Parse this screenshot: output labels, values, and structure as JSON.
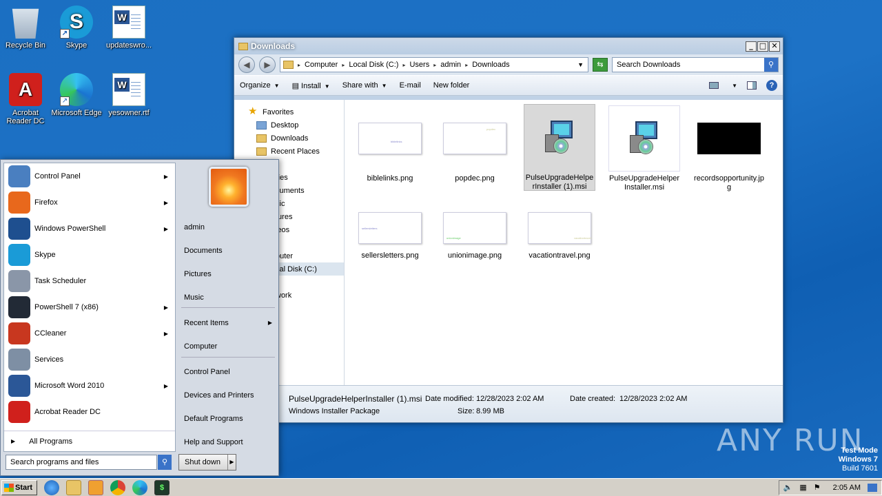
{
  "desktop": {
    "icons": [
      {
        "label": "Recycle Bin"
      },
      {
        "label": "Skype"
      },
      {
        "label": "updateswro..."
      },
      {
        "label": "Acrobat Reader DC"
      },
      {
        "label": "Microsoft Edge"
      },
      {
        "label": "yesowner.rtf"
      }
    ]
  },
  "explorer": {
    "title": "Downloads",
    "nav_back": "◀",
    "nav_forward": "▶",
    "breadcrumb": [
      "Computer",
      "Local Disk (C:)",
      "Users",
      "admin",
      "Downloads"
    ],
    "search_placeholder": "Search Downloads",
    "toolbar": {
      "organize": "Organize",
      "install": "Install",
      "share_with": "Share with",
      "email": "E-mail",
      "new_folder": "New folder"
    },
    "navpane": [
      {
        "label": "Favorites"
      },
      {
        "label": "Desktop"
      },
      {
        "label": "Downloads"
      },
      {
        "label": "Recent Places"
      },
      {
        "label": "ries"
      },
      {
        "label": "cuments"
      },
      {
        "label": "sic"
      },
      {
        "label": "tures"
      },
      {
        "label": "leos"
      },
      {
        "label": "puter"
      },
      {
        "label": "cal Disk (C:)"
      },
      {
        "label": "work"
      }
    ],
    "files": [
      {
        "name": "biblelinks.png",
        "thumb_text": "biblelinks"
      },
      {
        "name": "popdec.png",
        "thumb_text": "popdec"
      },
      {
        "name": "PulseUpgradeHelperInstaller (1).msi"
      },
      {
        "name": "PulseUpgradeHelperInstaller.msi"
      },
      {
        "name": "recordsopportunity.jpg"
      },
      {
        "name": "sellersletters.png",
        "thumb_text": "sellersletters"
      },
      {
        "name": "unionimage.png",
        "thumb_text": "unionimage"
      },
      {
        "name": "vacationtravel.png",
        "thumb_text": "vacationtravel"
      }
    ],
    "details": {
      "filename": "PulseUpgradeHelperInstaller (1).msi",
      "modified_label": "Date modified:",
      "modified_value": "12/28/2023 2:02 AM",
      "created_label": "Date created:",
      "created_value": "12/28/2023 2:02 AM",
      "type": "Windows Installer Package",
      "size_label": "Size:",
      "size_value": "8.99 MB"
    }
  },
  "start_menu": {
    "programs": [
      {
        "label": "Control Panel",
        "arrow": true,
        "color": "#4a7fc0"
      },
      {
        "label": "Firefox",
        "arrow": true,
        "color": "#e8681c"
      },
      {
        "label": "Windows PowerShell",
        "arrow": true,
        "color": "#1e4f8f"
      },
      {
        "label": "Skype",
        "arrow": false,
        "color": "#1a9bd7"
      },
      {
        "label": "Task Scheduler",
        "arrow": false,
        "color": "#8a96a8"
      },
      {
        "label": "PowerShell 7 (x86)",
        "arrow": true,
        "color": "#222a36"
      },
      {
        "label": "CCleaner",
        "arrow": true,
        "color": "#c8371f"
      },
      {
        "label": "Services",
        "arrow": false,
        "color": "#7e8fa4"
      },
      {
        "label": "Microsoft Word 2010",
        "arrow": true,
        "color": "#2b5797"
      },
      {
        "label": "Acrobat Reader DC",
        "arrow": false,
        "color": "#d0201c"
      }
    ],
    "all_programs": "All Programs",
    "right_items": {
      "admin": "admin",
      "documents": "Documents",
      "pictures": "Pictures",
      "music": "Music",
      "recent_items": "Recent Items",
      "computer": "Computer",
      "control_panel": "Control Panel",
      "devices_printers": "Devices and Printers",
      "default_programs": "Default Programs",
      "help_support": "Help and Support"
    },
    "search_placeholder": "Search programs and files",
    "shutdown": "Shut down"
  },
  "taskbar": {
    "start": "Start",
    "clock": "2:05 AM"
  },
  "watermark": {
    "line1": "Test Mode",
    "line2": "Windows 7",
    "line3": "Build 7601",
    "brand": "ANY RUN"
  }
}
